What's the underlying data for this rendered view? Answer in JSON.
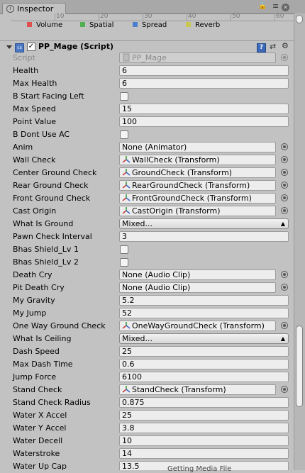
{
  "window": {
    "tab_label": "Inspector"
  },
  "mixer_ruler": {
    "ticks": [
      "10",
      "20",
      "30",
      "40",
      "50",
      "60"
    ]
  },
  "mixer_legend": [
    {
      "label": "Volume",
      "color": "#e05050"
    },
    {
      "label": "Spatial",
      "color": "#50b050"
    },
    {
      "label": "Spread",
      "color": "#4a7fd0"
    },
    {
      "label": "Reverb",
      "color": "#c8c850"
    }
  ],
  "component": {
    "title": "PP_Mage (Script)",
    "enabled": true
  },
  "props": {
    "script": {
      "label": "Script",
      "value": "PP_Mage"
    },
    "health": {
      "label": "Health",
      "value": "6"
    },
    "max_health": {
      "label": "Max Health",
      "value": "6"
    },
    "b_start_facing_left": {
      "label": "B Start Facing Left",
      "checked": false
    },
    "max_speed": {
      "label": "Max Speed",
      "value": "15"
    },
    "point_value": {
      "label": "Point Value",
      "value": "100"
    },
    "b_dont_use_ac": {
      "label": "B Dont Use AC",
      "checked": false
    },
    "anim": {
      "label": "Anim",
      "value": "None (Animator)"
    },
    "wall_check": {
      "label": "Wall Check",
      "value": "WallCheck (Transform)"
    },
    "center_ground_check": {
      "label": "Center Ground Check",
      "value": "GroundCheck (Transform)"
    },
    "rear_ground_check": {
      "label": "Rear Ground Check",
      "value": "RearGroundCheck (Transform)"
    },
    "front_ground_check": {
      "label": "Front Ground Check",
      "value": "FrontGroundCheck (Transform)"
    },
    "cast_origin": {
      "label": "Cast Origin",
      "value": "CastOrigin (Transform)"
    },
    "what_is_ground": {
      "label": "What Is Ground",
      "value": "Mixed..."
    },
    "pawn_check_interval": {
      "label": "Pawn Check Interval",
      "value": "3"
    },
    "bhas_shield_lv1": {
      "label": "Bhas Shield_Lv 1",
      "checked": false
    },
    "bhas_shield_lv2": {
      "label": "Bhas Shield_Lv 2",
      "checked": false
    },
    "death_cry": {
      "label": "Death Cry",
      "value": "None (Audio Clip)"
    },
    "pit_death_cry": {
      "label": "Pit Death Cry",
      "value": "None (Audio Clip)"
    },
    "my_gravity": {
      "label": "My Gravity",
      "value": "5.2"
    },
    "my_jump": {
      "label": "My Jump",
      "value": "52"
    },
    "one_way_ground_check": {
      "label": "One Way Ground Check",
      "value": "OneWayGroundCheck (Transform)"
    },
    "what_is_ceiling": {
      "label": "What Is Ceiling",
      "value": "Mixed..."
    },
    "dash_speed": {
      "label": "Dash Speed",
      "value": "25"
    },
    "max_dash_time": {
      "label": "Max Dash Time",
      "value": "0.6"
    },
    "jump_force": {
      "label": "Jump Force",
      "value": "6100"
    },
    "stand_check": {
      "label": "Stand Check",
      "value": "StandCheck (Transform)"
    },
    "stand_check_radius": {
      "label": "Stand Check Radius",
      "value": "0.875"
    },
    "water_x_accel": {
      "label": "Water X Accel",
      "value": "25"
    },
    "water_y_accel": {
      "label": "Water Y Accel",
      "value": "3.8"
    },
    "water_decell": {
      "label": "Water Decell",
      "value": "10"
    },
    "waterstroke": {
      "label": "Waterstroke",
      "value": "14"
    },
    "water_up_cap": {
      "label": "Water Up Cap",
      "value": "13.5"
    }
  },
  "status": {
    "text": "Getting Media File"
  }
}
